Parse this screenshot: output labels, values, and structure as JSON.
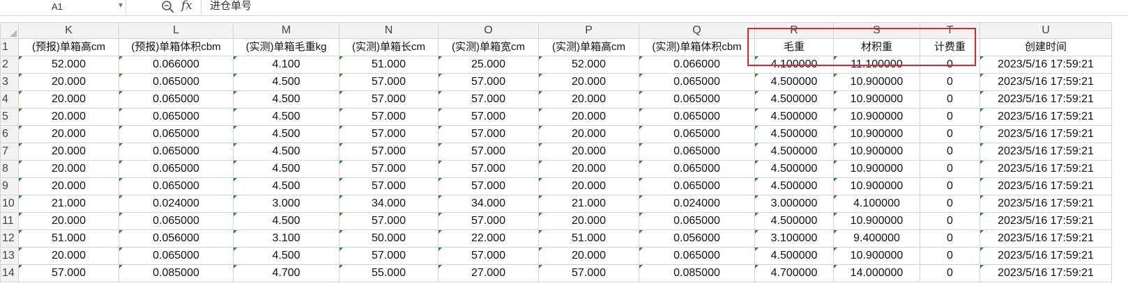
{
  "formula_bar": {
    "name_box": "A1",
    "fx_label": "fx",
    "formula": "进仓单号"
  },
  "columns": [
    "K",
    "L",
    "M",
    "N",
    "O",
    "P",
    "Q",
    "R",
    "S",
    "T",
    "U"
  ],
  "header_row": {
    "row_number": "1",
    "cells": [
      "(预报)单箱高cm",
      "(预报)单箱体积cbm",
      "(实测)单箱毛重kg",
      "(实测)单箱长cm",
      "(实测)单箱宽cm",
      "(实测)单箱高cm",
      "(实测)单箱体积cbm",
      "毛重",
      "材积重",
      "计费重",
      "创建时间"
    ]
  },
  "rows": [
    {
      "n": "2",
      "c": [
        "52.000",
        "0.066000",
        "4.100",
        "51.000",
        "25.000",
        "52.000",
        "0.066000",
        "4.100000",
        "11.100000",
        "0",
        "2023/5/16 17:59:21"
      ]
    },
    {
      "n": "3",
      "c": [
        "20.000",
        "0.065000",
        "4.500",
        "57.000",
        "57.000",
        "20.000",
        "0.065000",
        "4.500000",
        "10.900000",
        "0",
        "2023/5/16 17:59:21"
      ]
    },
    {
      "n": "4",
      "c": [
        "20.000",
        "0.065000",
        "4.500",
        "57.000",
        "57.000",
        "20.000",
        "0.065000",
        "4.500000",
        "10.900000",
        "0",
        "2023/5/16 17:59:21"
      ]
    },
    {
      "n": "5",
      "c": [
        "20.000",
        "0.065000",
        "4.500",
        "57.000",
        "57.000",
        "20.000",
        "0.065000",
        "4.500000",
        "10.900000",
        "0",
        "2023/5/16 17:59:21"
      ]
    },
    {
      "n": "6",
      "c": [
        "20.000",
        "0.065000",
        "4.500",
        "57.000",
        "57.000",
        "20.000",
        "0.065000",
        "4.500000",
        "10.900000",
        "0",
        "2023/5/16 17:59:21"
      ]
    },
    {
      "n": "7",
      "c": [
        "20.000",
        "0.065000",
        "4.500",
        "57.000",
        "57.000",
        "20.000",
        "0.065000",
        "4.500000",
        "10.900000",
        "0",
        "2023/5/16 17:59:21"
      ]
    },
    {
      "n": "8",
      "c": [
        "20.000",
        "0.065000",
        "4.500",
        "57.000",
        "57.000",
        "20.000",
        "0.065000",
        "4.500000",
        "10.900000",
        "0",
        "2023/5/16 17:59:21"
      ]
    },
    {
      "n": "9",
      "c": [
        "20.000",
        "0.065000",
        "4.500",
        "57.000",
        "57.000",
        "20.000",
        "0.065000",
        "4.500000",
        "10.900000",
        "0",
        "2023/5/16 17:59:21"
      ]
    },
    {
      "n": "10",
      "c": [
        "21.000",
        "0.024000",
        "3.000",
        "34.000",
        "34.000",
        "21.000",
        "0.024000",
        "3.000000",
        "4.100000",
        "0",
        "2023/5/16 17:59:21"
      ]
    },
    {
      "n": "11",
      "c": [
        "20.000",
        "0.065000",
        "4.500",
        "57.000",
        "57.000",
        "20.000",
        "0.065000",
        "4.500000",
        "10.900000",
        "0",
        "2023/5/16 17:59:21"
      ]
    },
    {
      "n": "12",
      "c": [
        "51.000",
        "0.056000",
        "3.100",
        "50.000",
        "22.000",
        "51.000",
        "0.056000",
        "3.100000",
        "9.400000",
        "0",
        "2023/5/16 17:59:21"
      ]
    },
    {
      "n": "13",
      "c": [
        "20.000",
        "0.065000",
        "4.500",
        "57.000",
        "57.000",
        "20.000",
        "0.065000",
        "4.500000",
        "10.900000",
        "0",
        "2023/5/16 17:59:21"
      ]
    },
    {
      "n": "14",
      "c": [
        "57.000",
        "0.085000",
        "4.700",
        "55.000",
        "27.000",
        "57.000",
        "0.085000",
        "4.700000",
        "14.000000",
        "0",
        "2023/5/16 17:59:21"
      ]
    }
  ],
  "colors": {
    "highlight_border": "#e0242d",
    "text_flag": "#1e8a3a",
    "header_bg": "#f3f3f3",
    "gridline": "#d4d4d4"
  }
}
